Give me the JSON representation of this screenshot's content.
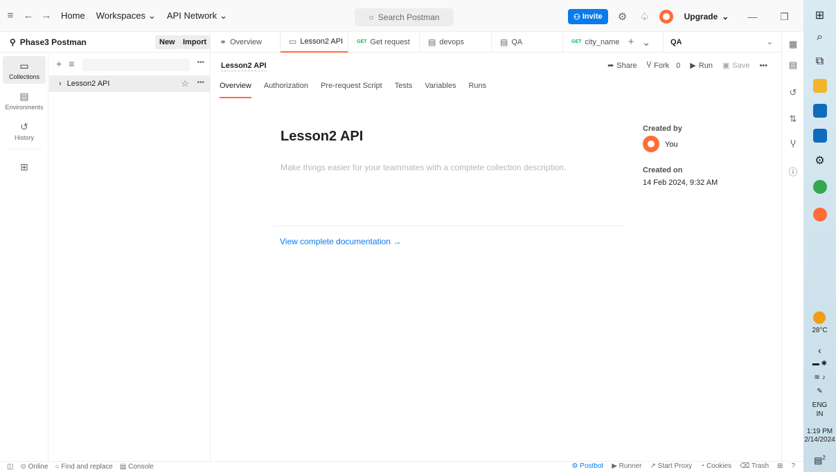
{
  "titlebar": {
    "home": "Home",
    "workspaces": "Workspaces",
    "api_network": "API Network",
    "search_placeholder": "Search Postman",
    "invite": "Invite",
    "upgrade": "Upgrade"
  },
  "workspace": {
    "name": "Phase3 Postman",
    "new_label": "New",
    "import_label": "Import"
  },
  "sidebar": {
    "items": [
      {
        "label": "Collections",
        "icon": "collections-icon"
      },
      {
        "label": "Environments",
        "icon": "environments-icon"
      },
      {
        "label": "History",
        "icon": "history-icon"
      }
    ],
    "collection_name": "Lesson2 API"
  },
  "tabs": [
    {
      "label": "Overview",
      "method": ""
    },
    {
      "label": "Lesson2 API",
      "method": ""
    },
    {
      "label": "Get request",
      "method": "GET"
    },
    {
      "label": "devops",
      "method": ""
    },
    {
      "label": "QA",
      "method": ""
    },
    {
      "label": "city_name",
      "method": "GET"
    }
  ],
  "environment": "QA",
  "request": {
    "title": "Lesson2 API",
    "share": "Share",
    "fork": "Fork",
    "fork_count": "0",
    "run": "Run",
    "save": "Save"
  },
  "subtabs": [
    "Overview",
    "Authorization",
    "Pre-request Script",
    "Tests",
    "Variables",
    "Runs"
  ],
  "overview": {
    "title": "Lesson2 API",
    "description": "Make things easier for your teammates with a complete collection description.",
    "doc_link": "View complete documentation →",
    "created_by_label": "Created by",
    "created_by": "You",
    "created_on_label": "Created on",
    "created_on": "14 Feb 2024, 9:32 AM"
  },
  "statusbar": {
    "online": "Online",
    "find_replace": "Find and replace",
    "console": "Console",
    "postbot": "Postbot",
    "runner": "Runner",
    "start_proxy": "Start Proxy",
    "cookies": "Cookies",
    "trash": "Trash"
  },
  "taskbar": {
    "temperature": "28°C",
    "lang": "ENG",
    "region": "IN",
    "time": "1:19 PM",
    "date": "2/14/2024",
    "notifications": "2"
  },
  "colors": {
    "accent": "#ff6c37",
    "primary": "#097bed",
    "get_method": "#0cbb52"
  }
}
